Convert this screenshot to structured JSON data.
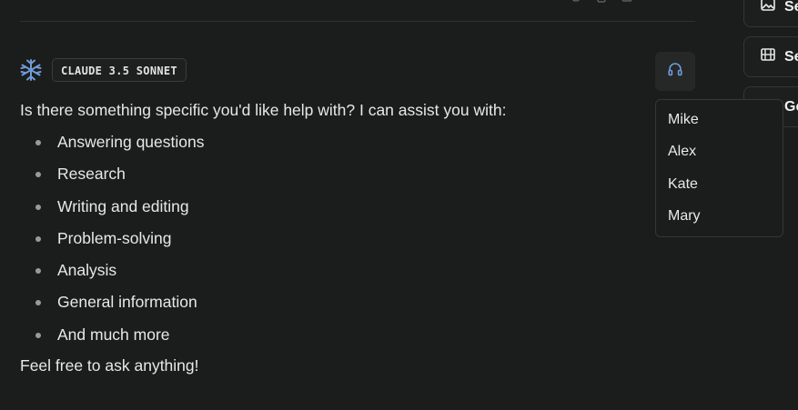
{
  "header": {
    "model_label": "CLAUDE 3.5 SONNET"
  },
  "icons": {
    "logo": "claude-logo-icon",
    "audio": "headphones-icon"
  },
  "colors": {
    "accent": "#6f9bd8",
    "background": "#1b1c1c",
    "text": "#e8e8e6"
  },
  "message": {
    "intro": "Is there something specific you'd like help with? I can assist you with:",
    "items": [
      "Answering questions",
      "Research",
      "Writing and editing",
      "Problem-solving",
      "Analysis",
      "General information",
      "And much more"
    ],
    "outro": "Feel free to ask anything!"
  },
  "voice_menu": {
    "options": [
      "Mike",
      "Alex",
      "Kate",
      "Mary"
    ]
  },
  "sidebar": {
    "cards": [
      {
        "label": "Se",
        "icon": "image-icon"
      },
      {
        "label": "Se",
        "icon": "film-icon"
      },
      {
        "label": "Ge",
        "icon": ""
      }
    ]
  }
}
